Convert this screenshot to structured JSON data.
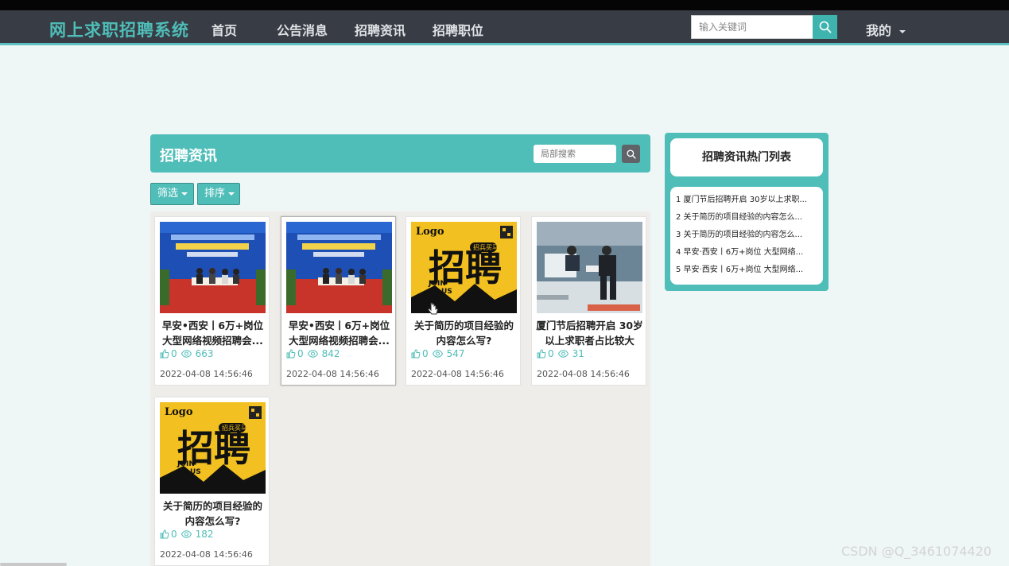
{
  "navbar": {
    "brand": "网上求职招聘系统",
    "items": [
      "首页",
      "公告消息",
      "招聘资讯",
      "招聘职位"
    ],
    "search_placeholder": "输入关键词",
    "mine": "我的"
  },
  "news": {
    "title": "招聘资讯",
    "local_search_placeholder": "局部搜索",
    "filter_label": "筛选",
    "sort_label": "排序"
  },
  "cards": [
    {
      "title": "早安•西安丨6万+岗位大型网络视频招聘会...",
      "likes": "0",
      "views": "663",
      "date": "2022-04-08 14:56:46",
      "image": "stage-forum"
    },
    {
      "title": "早安•西安丨6万+岗位大型网络视频招聘会...",
      "likes": "0",
      "views": "842",
      "date": "2022-04-08 14:56:46",
      "image": "stage-forum"
    },
    {
      "title": "关于简历的项目经验的内容怎么写?",
      "likes": "0",
      "views": "547",
      "date": "2022-04-08 14:56:46",
      "image": "join-us-poster"
    },
    {
      "title": "厦门节后招聘开启 30岁以上求职者占比较大",
      "likes": "0",
      "views": "31",
      "date": "2022-04-08 14:56:46",
      "image": "office-interview"
    },
    {
      "title": "关于简历的项目经验的内容怎么写?",
      "likes": "0",
      "views": "182",
      "date": "2022-04-08 14:56:46",
      "image": "join-us-poster"
    }
  ],
  "poster": {
    "logo": "Logo",
    "main": "招聘",
    "join": "JOIN",
    "us": "US",
    "badge": "招兵买马"
  },
  "hot": {
    "title": "招聘资讯热门列表",
    "items": [
      "1  厦门节后招聘开启 30岁以上求职...",
      "2  关于简历的项目经验的内容怎么...",
      "3  关于简历的项目经验的内容怎么...",
      "4  早安·西安丨6万+岗位 大型网络...",
      "5  早安·西安丨6万+岗位 大型网络..."
    ]
  },
  "watermark": "CSDN @Q_3461074420",
  "colors": {
    "accent": "#4fbdb8",
    "navbar": "#383c44"
  }
}
